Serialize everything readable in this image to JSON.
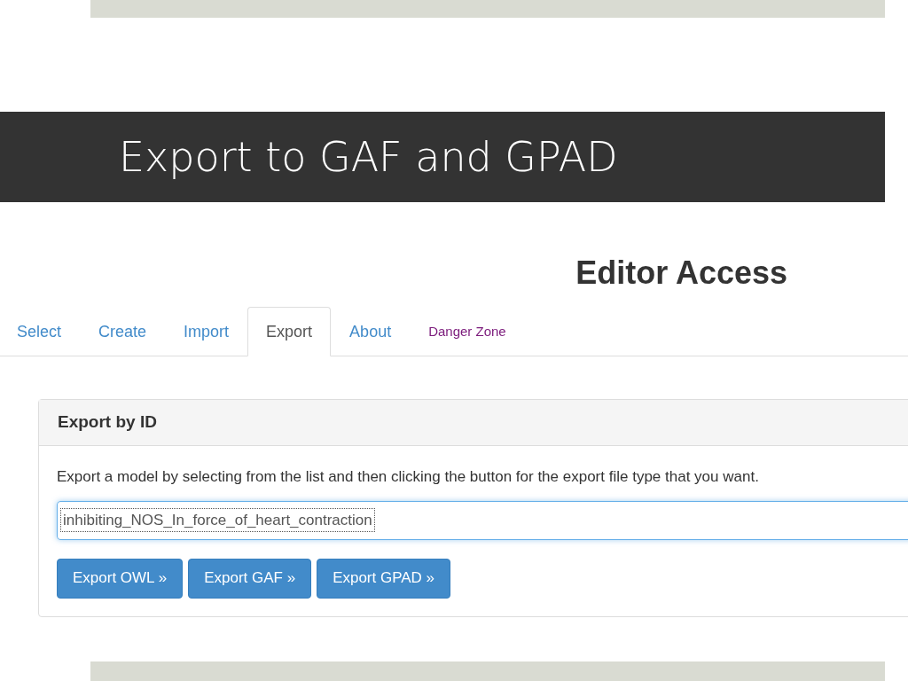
{
  "slide": {
    "title": "Export to GAF and GPAD"
  },
  "screenshot": {
    "heading": "Editor Access",
    "tabs": [
      {
        "label": "Select",
        "selected": false,
        "kind": "normal"
      },
      {
        "label": "Create",
        "selected": false,
        "kind": "normal"
      },
      {
        "label": "Import",
        "selected": false,
        "kind": "normal"
      },
      {
        "label": "Export",
        "selected": true,
        "kind": "normal"
      },
      {
        "label": "About",
        "selected": false,
        "kind": "normal"
      },
      {
        "label": "Danger Zone",
        "selected": false,
        "kind": "danger"
      }
    ],
    "panel": {
      "title": "Export by ID",
      "description": "Export a model by selecting from the list and then clicking the button for the export file type that you want.",
      "select_value": "inhibiting_NOS_In_force_of_heart_contraction",
      "buttons": [
        "Export OWL »",
        "Export GAF »",
        "Export GPAD »"
      ]
    }
  }
}
